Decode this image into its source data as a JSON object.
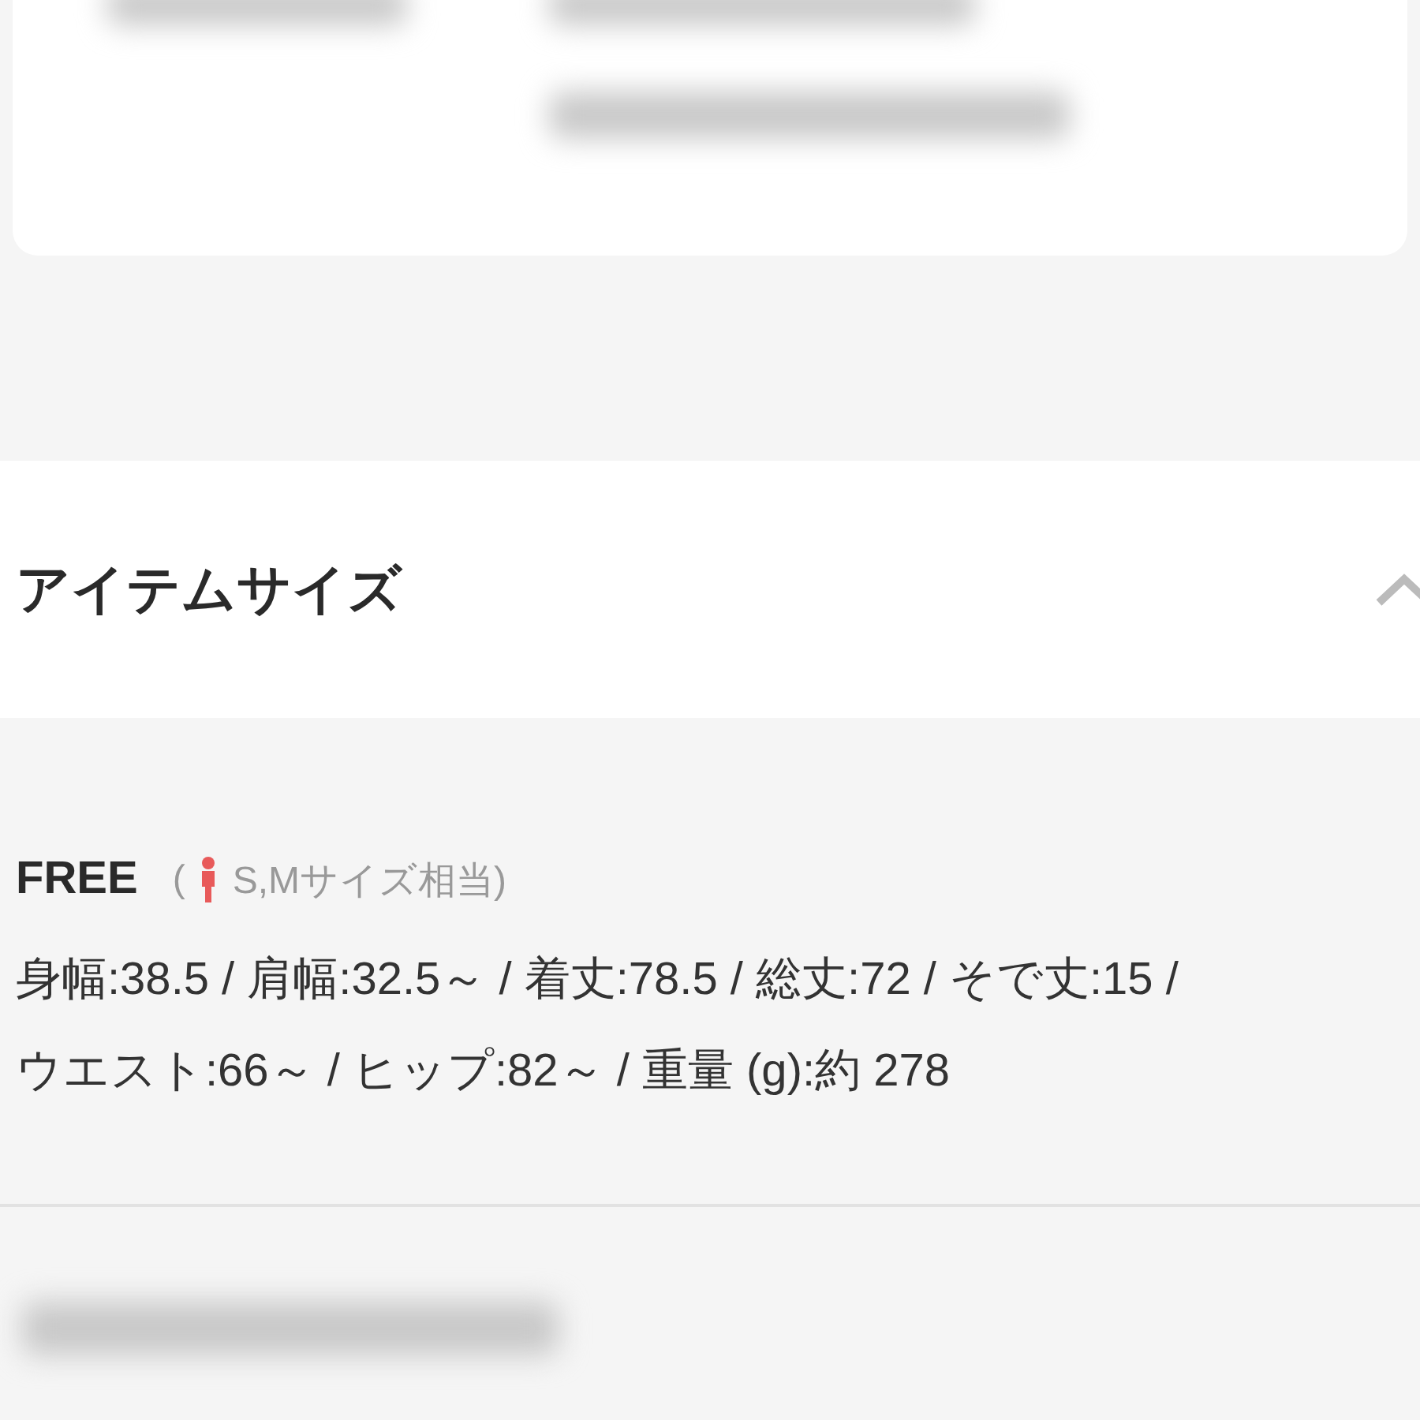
{
  "section": {
    "title": "アイテムサイズ",
    "expanded": true
  },
  "sizes": [
    {
      "name": "FREE",
      "open_paren": "(",
      "equivalent": "S,Mサイズ相当)",
      "spec_lines": [
        "身幅:38.5 / 肩幅:32.5～ / 着丈:78.5 / 総丈:72 / そで丈:15 /",
        "ウエスト:66～ / ヒップ:82～ / 重量 (g):約 278"
      ]
    }
  ]
}
